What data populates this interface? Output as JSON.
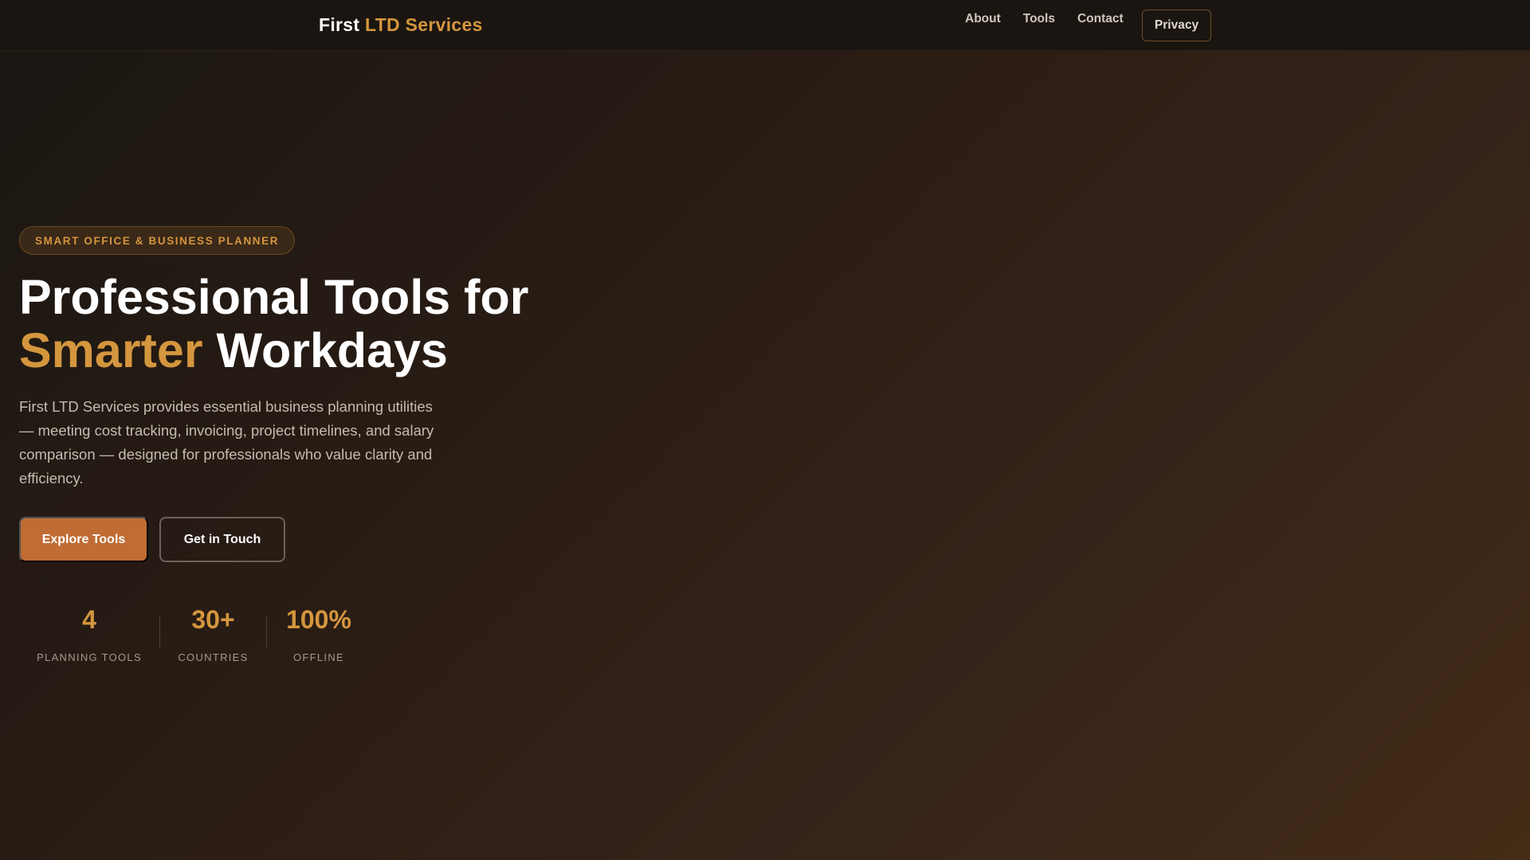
{
  "nav": {
    "logo_first": "First",
    "logo_accent": "LTD Services",
    "links": [
      "About",
      "Tools",
      "Contact"
    ],
    "privacy": "Privacy"
  },
  "hero": {
    "badge": "SMART OFFICE & BUSINESS PLANNER",
    "title_line1": "Professional Tools for",
    "title_accent": "Smarter",
    "title_rest": "Workdays",
    "description": "First LTD Services provides essential business planning utilities — meeting cost tracking, invoicing, project timelines, and salary comparison — designed for professionals who value clarity and efficiency.",
    "primary_button": "Explore Tools",
    "secondary_button": "Get in Touch"
  },
  "stats": [
    {
      "value": "4",
      "label": "PLANNING TOOLS"
    },
    {
      "value": "30+",
      "label": "COUNTRIES"
    },
    {
      "value": "100%",
      "label": "OFFLINE"
    }
  ],
  "colors": {
    "accent": "#d4963e",
    "button": "#c06c34"
  }
}
